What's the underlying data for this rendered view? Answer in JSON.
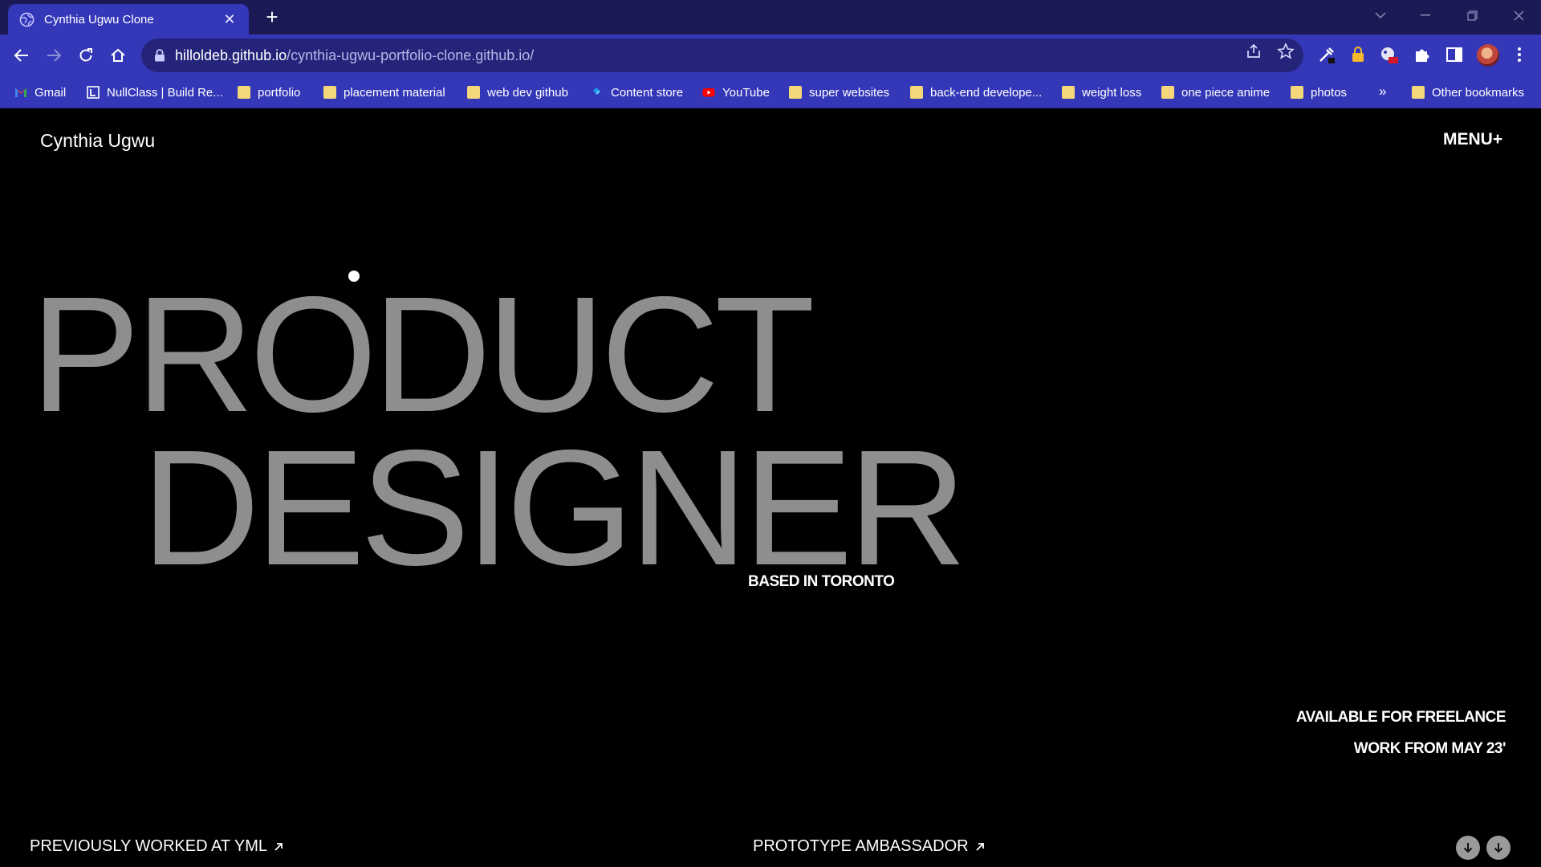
{
  "browser": {
    "tab_title": "Cynthia Ugwu Clone",
    "url_host": "hilloldeb.github.io",
    "url_path": "/cynthia-ugwu-portfolio-clone.github.io/",
    "bookmarks": [
      {
        "label": "Gmail",
        "icon": "gmail-icon"
      },
      {
        "label": "NullClass | Build Re...",
        "icon": "nullclass-icon"
      },
      {
        "label": "portfolio",
        "icon": "folder-icon"
      },
      {
        "label": "placement material",
        "icon": "folder-icon"
      },
      {
        "label": "web dev github",
        "icon": "folder-icon"
      },
      {
        "label": "Content store",
        "icon": "content-store-icon"
      },
      {
        "label": "YouTube",
        "icon": "youtube-icon"
      },
      {
        "label": "super websites",
        "icon": "folder-icon"
      },
      {
        "label": "back-end develope...",
        "icon": "folder-icon"
      },
      {
        "label": "weight loss",
        "icon": "folder-icon"
      },
      {
        "label": "one piece anime",
        "icon": "folder-icon"
      },
      {
        "label": "photos",
        "icon": "folder-icon"
      }
    ],
    "more_bookmarks": "»",
    "other_bookmarks": "Other bookmarks"
  },
  "site": {
    "brand": "Cynthia Ugwu",
    "menu_label": "MENU+",
    "hero_line_1": "PRODUCT",
    "hero_line_2": "DESIGNER",
    "based_in": "BASED IN TORONTO",
    "availability_1": "AVAILABLE FOR FREELANCE",
    "availability_2": "WORK FROM MAY 23'",
    "footer_left": "PREVIOUSLY WORKED AT YML",
    "footer_center": "PROTOTYPE AMBASSADOR"
  },
  "colors": {
    "tabstrip": "#1b1a55",
    "toolbar": "#3438b8",
    "page_bg": "#000000",
    "hero_text": "#8e8e8e"
  }
}
